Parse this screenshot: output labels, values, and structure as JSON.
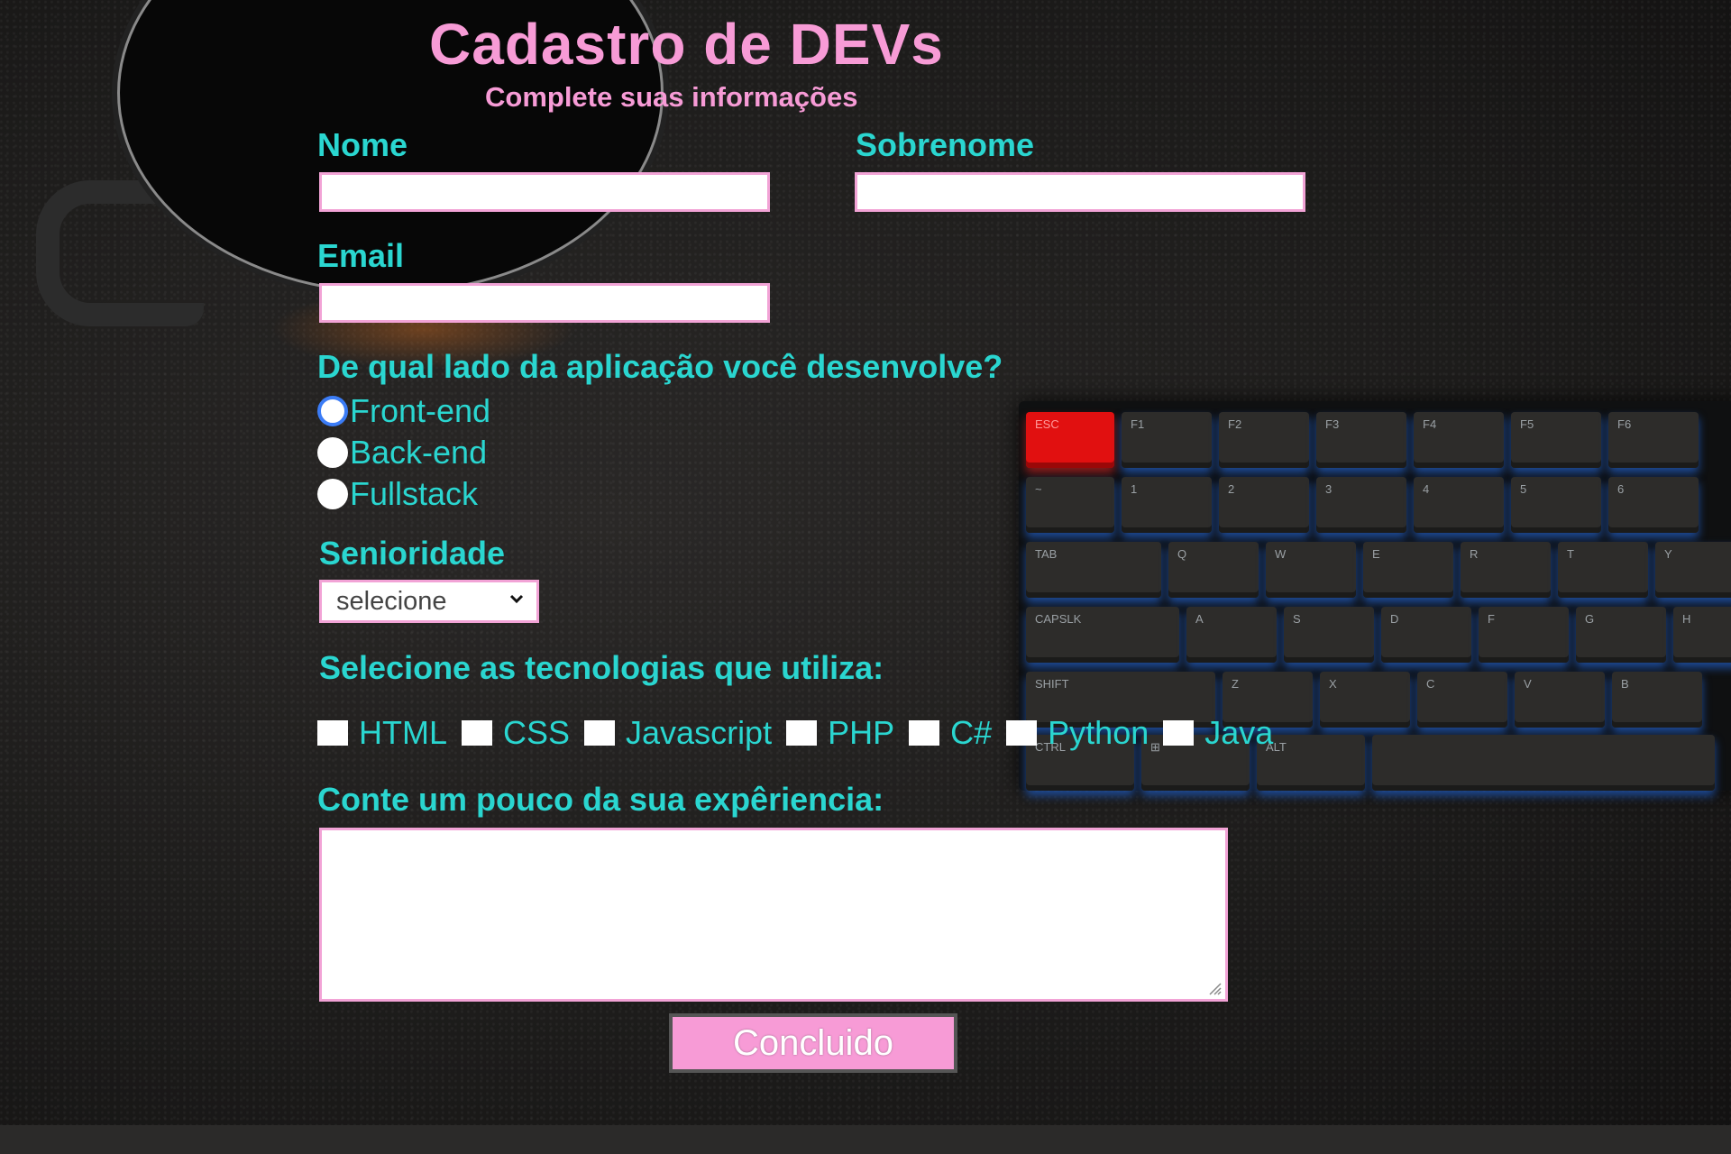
{
  "header": {
    "title": "Cadastro de DEVs",
    "subtitle": "Complete suas informações"
  },
  "form": {
    "nome": {
      "label": "Nome",
      "value": ""
    },
    "sobrenome": {
      "label": "Sobrenome",
      "value": ""
    },
    "email": {
      "label": "Email",
      "value": ""
    },
    "lado": {
      "question": "De qual lado da aplicação você desenvolve?",
      "options": [
        {
          "label": "Front-end",
          "checked": true
        },
        {
          "label": "Back-end",
          "checked": false
        },
        {
          "label": "Fullstack",
          "checked": false
        }
      ]
    },
    "senioridade": {
      "label": "Senioridade",
      "selected": "selecione"
    },
    "tecnologias": {
      "label": "Selecione as tecnologias que utiliza:",
      "options": [
        "HTML",
        "CSS",
        "Javascript",
        "PHP",
        "C#",
        "Python",
        "Java"
      ]
    },
    "experiencia": {
      "label": "Conte um pouco da sua expêriencia:",
      "value": ""
    },
    "submit_label": "Concluido"
  },
  "background": {
    "keyboard": {
      "row1": [
        "ESC",
        "F1",
        "F2",
        "F3",
        "F4",
        "F5",
        "F6"
      ],
      "row2": [
        "~",
        "1",
        "2",
        "3",
        "4",
        "5",
        "6"
      ],
      "row3": [
        "TAB",
        "Q",
        "W",
        "E",
        "R",
        "T",
        "Y"
      ],
      "row4": [
        "CAPSLK",
        "A",
        "S",
        "D",
        "F",
        "G",
        "H"
      ],
      "row5": [
        "SHIFT",
        "Z",
        "X",
        "C",
        "V",
        "B"
      ],
      "row6": [
        "CTRL",
        "⊞",
        "ALT"
      ]
    }
  },
  "colors": {
    "title": "#f79bd6",
    "label": "#2ad6d0",
    "input_border": "#f2a3d6",
    "button_bg": "#f79bd6",
    "radio_accent": "#3b7cf6"
  }
}
